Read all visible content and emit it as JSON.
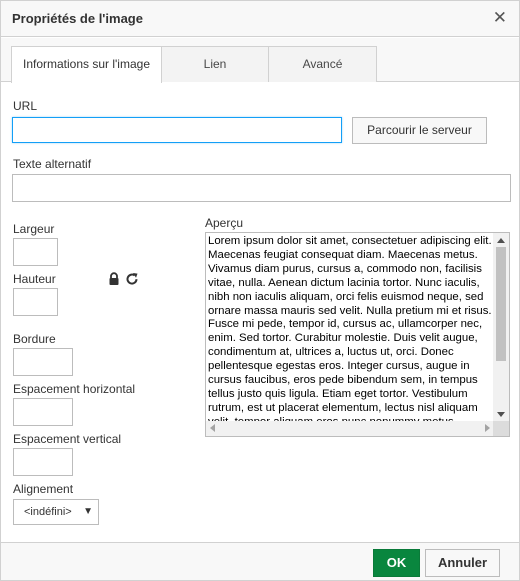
{
  "dialog": {
    "title": "Propriétés de l'image",
    "close_icon": "close-icon"
  },
  "tabs": [
    {
      "label": "Informations sur l'image",
      "active": true
    },
    {
      "label": "Lien",
      "active": false
    },
    {
      "label": "Avancé",
      "active": false
    }
  ],
  "fields": {
    "url_label": "URL",
    "url_value": "",
    "browse_button": "Parcourir le serveur",
    "alt_label": "Texte alternatif",
    "alt_value": "",
    "width_label": "Largeur",
    "width_value": "",
    "height_label": "Hauteur",
    "height_value": "",
    "lock_icon": "lock-icon",
    "reset_icon": "reset-size-icon",
    "border_label": "Bordure",
    "border_value": "",
    "hspace_label": "Espacement horizontal",
    "hspace_value": "",
    "vspace_label": "Espacement vertical",
    "vspace_value": "",
    "align_label": "Alignement",
    "align_value": "<indéfini>"
  },
  "preview": {
    "label": "Aperçu",
    "text": "Lorem ipsum dolor sit amet, consectetuer adipiscing elit. Maecenas feugiat consequat diam. Maecenas metus. Vivamus diam purus, cursus a, commodo non, facilisis vitae, nulla. Aenean dictum lacinia tortor. Nunc iaculis, nibh non iaculis aliquam, orci felis euismod neque, sed ornare massa mauris sed velit. Nulla pretium mi et risus. Fusce mi pede, tempor id, cursus ac, ullamcorper nec, enim. Sed tortor. Curabitur molestie. Duis velit augue, condimentum at, ultrices a, luctus ut, orci. Donec pellentesque egestas eros. Integer cursus, augue in cursus faucibus, eros pede bibendum sem, in tempus tellus justo quis ligula. Etiam eget tortor. Vestibulum rutrum, est ut placerat elementum, lectus nisl aliquam velit, tempor aliquam eros nunc nonummy metus."
  },
  "footer": {
    "ok_label": "OK",
    "cancel_label": "Annuler"
  },
  "colors": {
    "accent": "#139ff7",
    "ok_green": "#09863e"
  }
}
